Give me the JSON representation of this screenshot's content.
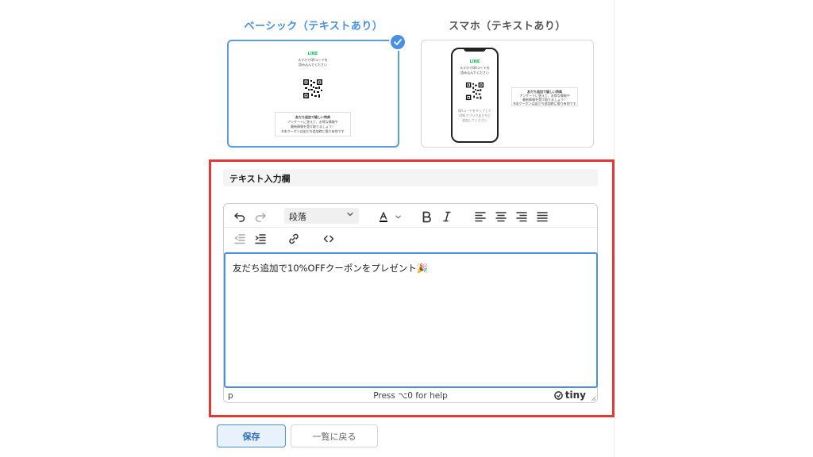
{
  "templates": {
    "selected": {
      "title": "ベーシック（テキストあり）",
      "preview": {
        "brand": "LINE",
        "lines_top": [
          "スマホでQRコードを",
          "読み込んでください"
        ],
        "box_title": "友だち追加で嬉しい特典",
        "box_lines": [
          "アンケートに答えて、お得な情報や",
          "最新情報を受け取りましょう！",
          "※本クーポンは友だち追加時に限り有効です"
        ]
      }
    },
    "other": {
      "title": "スマホ（テキストあり）",
      "preview": {
        "brand": "LINE",
        "lines_top": [
          "スマホでQRコードを",
          "読み込んでください"
        ],
        "phone_lines": [
          "QRコードをタップして",
          "LINEアプリで友だちに",
          "追加してください"
        ],
        "box_title": "友だち追加で嬉しい特典",
        "box_lines": [
          "アンケートに答えて、お得な情報や",
          "最新情報を受け取りましょう！",
          "※本クーポンは友だち追加時に限り有効です"
        ]
      }
    }
  },
  "field": {
    "label": "テキスト入力欄"
  },
  "editor": {
    "format_select": "段落",
    "content": "友だち追加で10%OFFクーポンをプレゼント🎉",
    "status_path": "p",
    "status_help": "Press ⌥0 for help",
    "brand": "tiny"
  },
  "actions": {
    "save": "保存",
    "back": "一覧に戻る"
  },
  "colors": {
    "accent": "#4a90e2",
    "highlight": "#e53935",
    "line_green": "#06c755"
  }
}
